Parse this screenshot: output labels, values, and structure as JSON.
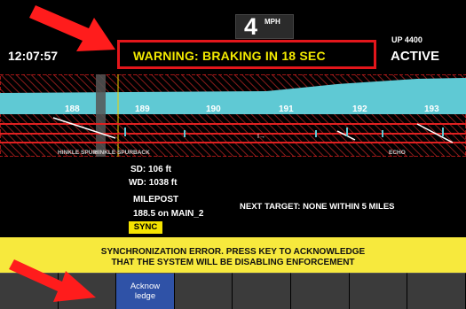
{
  "speed": {
    "value": "4",
    "unit": "MPH"
  },
  "clock": "12:07:57",
  "warning": "WARNING: BRAKING IN 18 SEC",
  "direction": "UP 4400",
  "status": "ACTIVE",
  "track": {
    "mileposts": [
      "188",
      "189",
      "190",
      "191",
      "192",
      "193"
    ],
    "labels": {
      "left": "HINKLE SPUR",
      "left2": "HINKLE SPUR",
      "mid": "BACK",
      "right": "ECHO"
    }
  },
  "info": {
    "sd": "SD:   106 ft",
    "wd": "WD:  1038 ft",
    "milepost_label": "MILEPOST",
    "milepost_value": "188.5  on  MAIN_2",
    "sync_label": "SYNC",
    "next_target": "NEXT TARGET: NONE WITHIN 5 MILES"
  },
  "message": {
    "line1": "SYNCHRONIZATION ERROR. PRESS KEY TO ACKNOWLEDGE",
    "line2": "THAT THE SYSTEM WILL BE DISABLING ENFORCEMENT"
  },
  "softkeys": [
    "",
    "",
    "Acknow ledge",
    "",
    "",
    "",
    "",
    ""
  ],
  "colors": {
    "warning_text": "#f3ea00",
    "warning_border": "#e3161b",
    "message_bar": "#f7e93d",
    "active_key": "#2f52a7",
    "terrain": "#5fc9d4"
  }
}
